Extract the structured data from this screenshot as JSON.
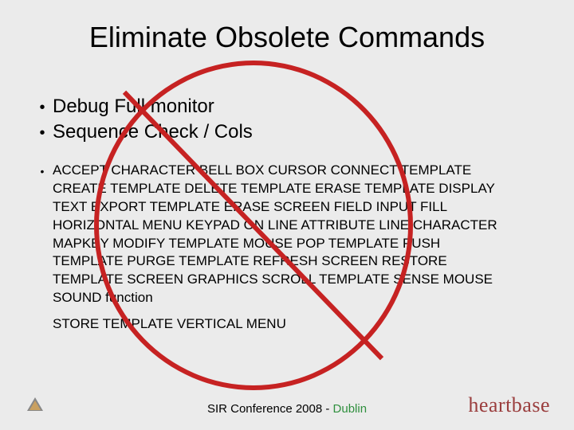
{
  "title": "Eliminate Obsolete Commands",
  "bullets": {
    "major": [
      "Debug Full monitor",
      "Sequence Check / Cols"
    ],
    "minor": {
      "para1": "ACCEPT CHARACTER BELL BOX CURSOR CONNECT TEMPLATE CREATE TEMPLATE DELETE TEMPLATE ERASE TEMPLATE DISPLAY TEXT EXPORT TEMPLATE ERASE SCREEN FIELD INPUT FILL HORIZONTAL MENU KEYPAD ON LINE ATTRIBUTE LINE CHARACTER MAPKEY MODIFY TEMPLATE MOUSE POP TEMPLATE PUSH TEMPLATE PURGE TEMPLATE REFRESH SCREEN RESTORE TEMPLATE SCREEN GRAPHICS SCROLL TEMPLATE SENSE MOUSE SOUND function",
      "para2": "STORE TEMPLATE VERTICAL MENU"
    }
  },
  "footer": {
    "conference": "SIR Conference 2008 - ",
    "location": "Dublin",
    "brand": "heartbase"
  }
}
